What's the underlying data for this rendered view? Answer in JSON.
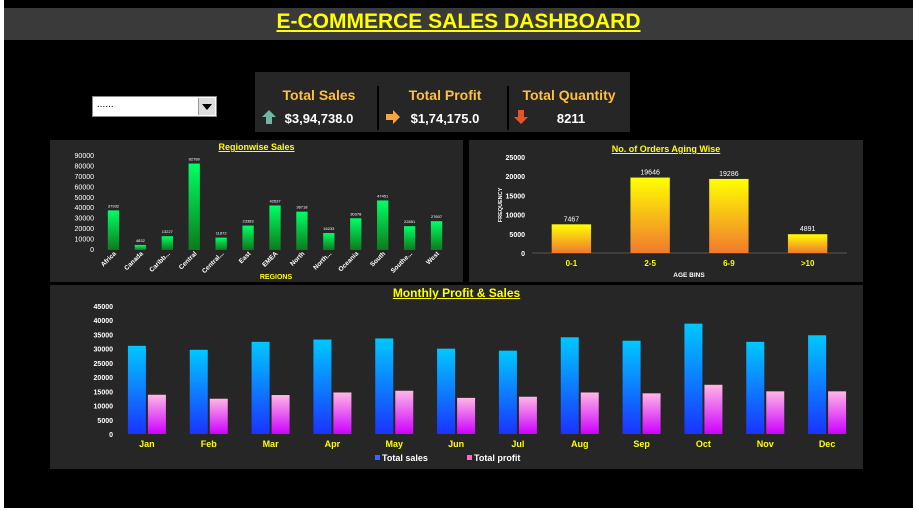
{
  "title": "E-COMMERCE SALES DASHBOARD",
  "filter": {
    "value": "......"
  },
  "kpis": [
    {
      "label": "Total Sales",
      "value": "$3,94,738.0",
      "icon": "arrow-up-icon",
      "color": "#6fb7a3"
    },
    {
      "label": "Total Profit",
      "value": "$1,74,175.0",
      "icon": "arrow-right-icon",
      "color": "#f5a640"
    },
    {
      "label": "Total Quantity",
      "value": "8211",
      "icon": "arrow-down-icon",
      "color": "#e5542a"
    }
  ],
  "charts": {
    "region_title": "Regionwise Sales",
    "aging_title": "No. of Orders Aging Wise",
    "monthly_title": "Monthly Profit & Sales"
  },
  "chart_data": [
    {
      "type": "bar",
      "title": "Regionwise Sales",
      "xlabel": "REGIONS",
      "ylabel": "",
      "categories": [
        "Africa",
        "Canada",
        "Caribb...",
        "Central",
        "Central...",
        "East",
        "EMEA",
        "North",
        "North...",
        "Oceania",
        "South",
        "Southe...",
        "West"
      ],
      "values": [
        37932,
        4832,
        13227,
        82789,
        11872,
        23383,
        42637,
        36718,
        16233,
        30378,
        47451,
        22851,
        27607
      ],
      "ylim": [
        0,
        90000
      ],
      "yticks": [
        0,
        10000,
        20000,
        30000,
        40000,
        50000,
        60000,
        70000,
        80000,
        90000
      ],
      "grid": false
    },
    {
      "type": "bar",
      "title": "No. of Orders Aging Wise",
      "xlabel": "AGE BINS",
      "ylabel": "FREQUENCY",
      "categories": [
        "0-1",
        "2-5",
        "6-9",
        ">10"
      ],
      "values": [
        7467,
        19646,
        19286,
        4891
      ],
      "ylim": [
        0,
        25000
      ],
      "yticks": [
        0,
        5000,
        10000,
        15000,
        20000,
        25000
      ],
      "grid": false
    },
    {
      "type": "bar",
      "title": "Monthly Profit & Sales",
      "xlabel": "",
      "ylabel": "",
      "categories": [
        "Jan",
        "Feb",
        "Mar",
        "Apr",
        "May",
        "Jun",
        "Jul",
        "Aug",
        "Sep",
        "Oct",
        "Nov",
        "Dec"
      ],
      "series": [
        {
          "name": "Total sales",
          "values": [
            31000,
            29600,
            32400,
            33200,
            33600,
            30000,
            29300,
            34000,
            32800,
            38800,
            32400,
            34700
          ]
        },
        {
          "name": "Total profit",
          "values": [
            13800,
            12400,
            13700,
            14600,
            15200,
            12700,
            13100,
            14600,
            14300,
            17300,
            15000,
            15000
          ]
        }
      ],
      "ylim": [
        0,
        45000
      ],
      "yticks": [
        0,
        5000,
        10000,
        15000,
        20000,
        25000,
        30000,
        35000,
        40000,
        45000
      ],
      "legend": "bottom",
      "grid": false
    }
  ]
}
